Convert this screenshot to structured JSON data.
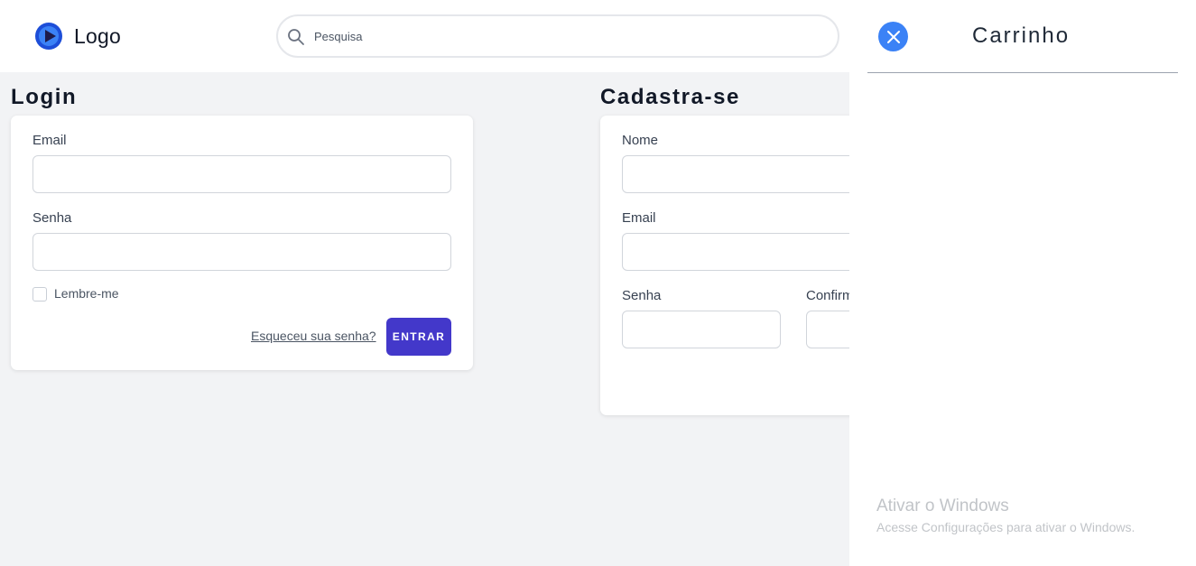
{
  "header": {
    "logo_text": "Logo",
    "search_placeholder": "Pesquisa"
  },
  "login": {
    "title": "Login",
    "email_label": "Email",
    "password_label": "Senha",
    "remember_label": "Lembre-me",
    "forgot_link": "Esqueceu sua senha?",
    "submit_label": "ENTRAR"
  },
  "register": {
    "title": "Cadastra-se",
    "name_label": "Nome",
    "email_label": "Email",
    "password_label": "Senha",
    "confirm_label": "Confirm"
  },
  "cart": {
    "title": "Carrinho"
  },
  "watermark": {
    "title": "Ativar o Windows",
    "subtitle": "Acesse Configurações para ativar o Windows."
  },
  "colors": {
    "accent": "#4338ca",
    "close_button": "#3b82f6",
    "page_bg": "#f2f3f5"
  },
  "icons": {
    "logo": "play-circle-icon",
    "search": "search-icon",
    "close": "close-icon"
  }
}
